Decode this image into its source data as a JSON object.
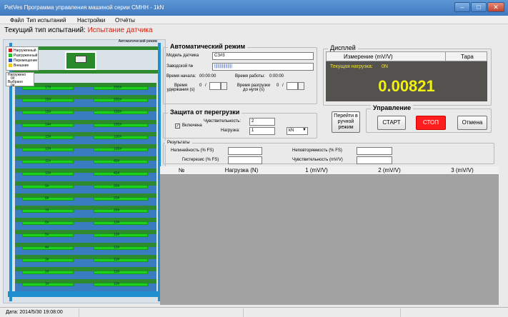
{
  "window": {
    "title": "PetVes Программа управления машиной серии СМНН - 1kN",
    "minimize": "–",
    "maximize": "□",
    "close": "✕"
  },
  "menu": [
    "Файл",
    "Тип испытаний",
    "Настройки",
    "Отчёты"
  ],
  "test_type": {
    "label": "Текущий тип испытаний:",
    "value": "Испытание датчика"
  },
  "legend": {
    "items": [
      {
        "label": "Нагруженный",
        "color": "#d82020"
      },
      {
        "label": "Разгруженный",
        "color": "#28c028"
      },
      {
        "label": "Перемещение",
        "color": "#2a58c8"
      },
      {
        "label": "Внешние",
        "color": "#e8c818"
      }
    ]
  },
  "load_info": {
    "loaded_label": "Нагружено",
    "loaded_value": "0#",
    "selected_label": "Выбрано",
    "selected_value": "0#"
  },
  "machine": {
    "auto_label": "Автоматический режим",
    "levels": [
      {
        "left": "17#",
        "right": "200#"
      },
      {
        "left": "16#",
        "right": "200#"
      },
      {
        "left": "15#",
        "right": "100#"
      },
      {
        "left": "14#",
        "right": "100#"
      },
      {
        "left": "13#",
        "right": "100#"
      },
      {
        "left": "12#",
        "right": "100#"
      },
      {
        "left": "11#",
        "right": "40#"
      },
      {
        "left": "10#",
        "right": "40#"
      },
      {
        "left": "9#",
        "right": "20#"
      },
      {
        "left": "8#",
        "right": "20#"
      },
      {
        "left": "7#",
        "right": "20#"
      },
      {
        "left": "6#",
        "right": "10#"
      },
      {
        "left": "5#",
        "right": "10#"
      },
      {
        "left": "4#",
        "right": "10#"
      },
      {
        "left": "3#",
        "right": "10#"
      },
      {
        "left": "2#",
        "right": "10#"
      },
      {
        "left": "1#",
        "right": "10#"
      }
    ]
  },
  "auto_mode": {
    "title": "Автоматический режим",
    "model_label": "Модель датчика",
    "model_value": "CЗ#3",
    "serial_label": "Заводской №",
    "serial_value": "||||||||||||||||",
    "start_label": "Время начала:",
    "start_value": "00:00:00",
    "work_label": "Время работы:",
    "work_value": "0:00:00",
    "hold_label": "Время удержания (s)",
    "hold_value": "0",
    "hold_sep": "/",
    "unload_label": "Время разгрузки до нуля (s)",
    "unload_value": "0",
    "unload_sep": "/"
  },
  "overload": {
    "title": "Защита от перегрузки",
    "enabled_label": "Включена",
    "sensitivity_label": "Чувствительность:",
    "sensitivity_value": "2",
    "load_label": "Нагрузка:",
    "load_value": "1",
    "unit_value": "kN"
  },
  "display": {
    "title": "Дисплей",
    "measurement_label": "Измерение (mV/V)",
    "tare_label": "Тара",
    "current_load_label": "Текущая нагрузка:",
    "current_load_value": "0N",
    "reading": "0.00821"
  },
  "control": {
    "title": "Управление",
    "manual_button": "Перейти в ручной режим",
    "start_button": "СТАРТ",
    "stop_button": "СТОП",
    "cancel_button": "Отмена"
  },
  "results": {
    "title": "Результаты",
    "nonlinearity_label": "Нелинейность (% FS)",
    "nonrepeat_label": "Неповторяемость (% FS)",
    "hysteresis_label": "Гистерезис (% FS)",
    "sensitivity_label": "Чувствительность (mV/V)"
  },
  "table": {
    "columns": [
      "№",
      "Нагрузка (N)",
      "1 (mV/V)",
      "2 (mV/V)",
      "3 (mV/V)"
    ]
  },
  "status": {
    "date": "Дата: 2014/5/30 19:08:00"
  },
  "colors": {
    "stop_red": "#ff1d1d",
    "reading_yellow": "#f1f213",
    "current_load_yellow": "#f0e43a",
    "plate_green": "#1fd11f",
    "column_blue": "#1f8fd0"
  }
}
